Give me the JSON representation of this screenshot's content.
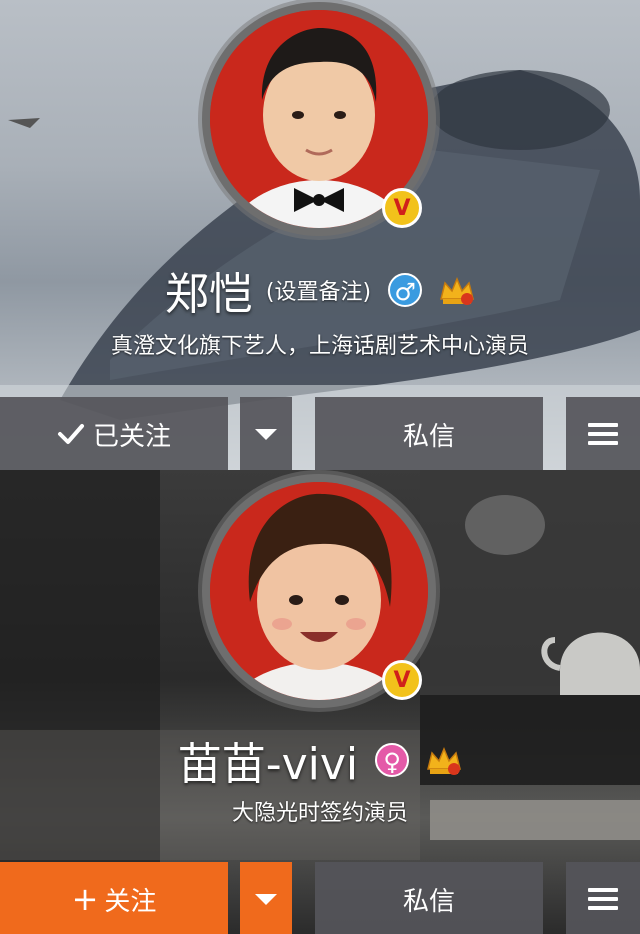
{
  "profiles": [
    {
      "name": "郑恺",
      "remark_label": "(设置备注)",
      "gender": "male",
      "gender_glyph": "♂",
      "gender_color": "#3a9be0",
      "bio": "真澄文化旗下艺人，上海话剧艺术中心演员",
      "verified_badge": "V",
      "follow_button_label": "已关注",
      "follow_state": "followed",
      "message_button_label": "私信",
      "accent": "#5a5a60"
    },
    {
      "name": "苗苗-vivi",
      "gender": "female",
      "gender_glyph": "♀",
      "gender_color": "#e45aa8",
      "bio": "大隐光时签约演员",
      "verified_badge": "V",
      "follow_button_label": "关注",
      "follow_state": "not_followed",
      "message_button_label": "私信",
      "accent": "#f06a1c"
    }
  ]
}
